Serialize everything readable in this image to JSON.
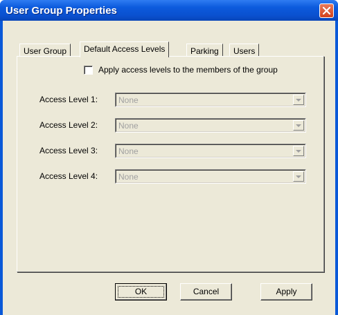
{
  "window": {
    "title": "User Group Properties",
    "close_icon": "close-icon"
  },
  "tabs": [
    {
      "label": "User Group",
      "active": false
    },
    {
      "label": "Default Access Levels",
      "active": true
    },
    {
      "label": "Parking",
      "active": false
    },
    {
      "label": "Users",
      "active": false
    }
  ],
  "panel": {
    "apply_checkbox": {
      "label": "Apply access levels to the members of the group",
      "checked": false
    },
    "levels": [
      {
        "label": "Access Level 1:",
        "value": "None"
      },
      {
        "label": "Access Level 2:",
        "value": "None"
      },
      {
        "label": "Access Level 3:",
        "value": "None"
      },
      {
        "label": "Access Level 4:",
        "value": "None"
      }
    ]
  },
  "buttons": {
    "ok": "OK",
    "cancel": "Cancel",
    "apply": "Apply"
  },
  "colors": {
    "titlebar": "#0a54d4",
    "dialog_bg": "#ece9d8",
    "close": "#d9522b",
    "disabled_text": "#a0a0a0"
  }
}
